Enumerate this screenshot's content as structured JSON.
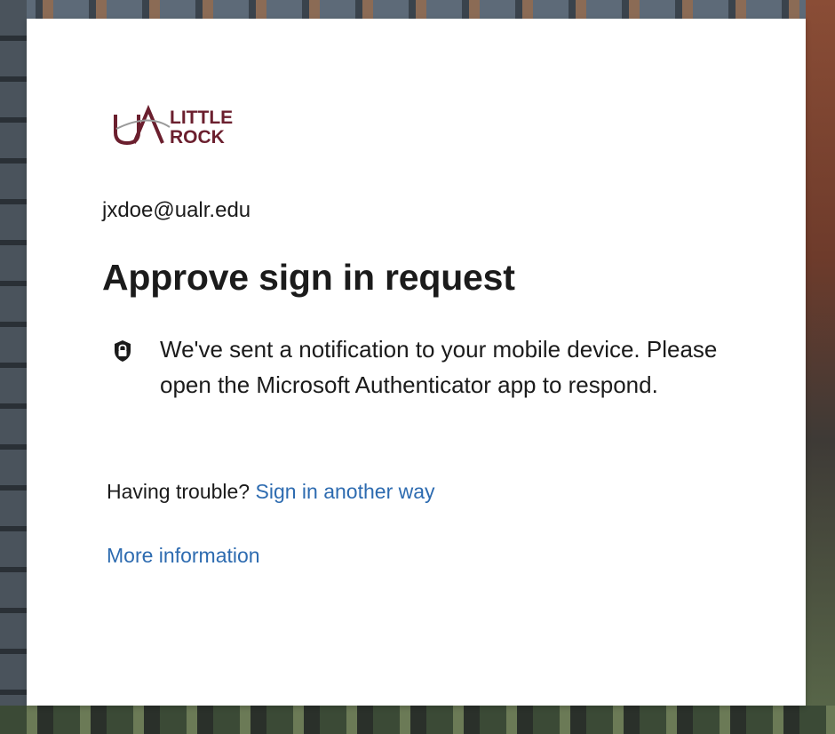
{
  "logo": {
    "monogram": "UA",
    "line1": "LITTLE",
    "line2": "ROCK",
    "brand_color": "#6b1f2e"
  },
  "account": {
    "email": "jxdoe@ualr.edu"
  },
  "heading": "Approve sign in request",
  "notice": {
    "icon": "lock-shield-icon",
    "text": "We've sent a notification to your mobile device. Please open the Microsoft Authenticator app to respond."
  },
  "help": {
    "prompt": "Having trouble?",
    "link_label": "Sign in another way"
  },
  "more_info_label": "More information",
  "colors": {
    "link": "#2d6bb0",
    "text": "#1b1b1b",
    "card": "#ffffff"
  }
}
